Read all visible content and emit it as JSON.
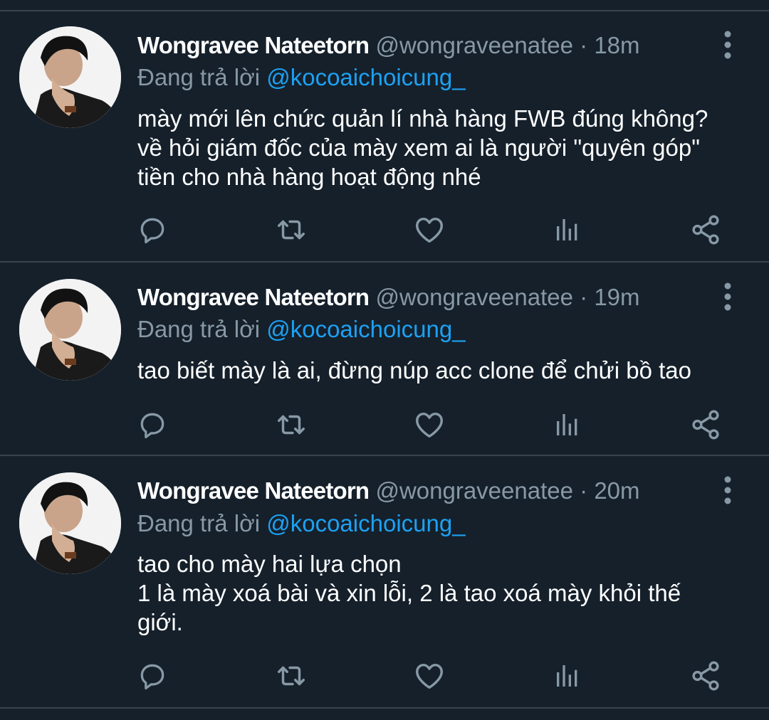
{
  "tweets": [
    {
      "author_name": "Wongravee Nateetorn",
      "handle": "@wongraveenatee",
      "separator": "·",
      "time": "18m",
      "reply_prefix": "Đang trả lời",
      "reply_to": "@kocoaichoicung_",
      "lines": [
        "mày mới lên chức quản lí nhà hàng FWB đúng không?",
        "về hỏi giám đốc của mày xem ai là người \"quyên góp\"",
        "tiền cho nhà hàng hoạt động nhé"
      ]
    },
    {
      "author_name": "Wongravee Nateetorn",
      "handle": "@wongraveenatee",
      "separator": "·",
      "time": "19m",
      "reply_prefix": "Đang trả lời",
      "reply_to": "@kocoaichoicung_",
      "lines": [
        "tao biết mày là ai, đừng núp acc clone để chửi bồ tao"
      ]
    },
    {
      "author_name": "Wongravee Nateetorn",
      "handle": "@wongraveenatee",
      "separator": "·",
      "time": "20m",
      "reply_prefix": "Đang trả lời",
      "reply_to": "@kocoaichoicung_",
      "lines": [
        "tao cho mày hai lựa chọn",
        "1 là mày xoá bài và xin lỗi, 2 là tao xoá mày khỏi thế",
        "giới."
      ]
    }
  ],
  "action_icons": [
    "reply-icon",
    "retweet-icon",
    "like-icon",
    "analytics-icon",
    "share-icon"
  ],
  "colors": {
    "background": "#15202b",
    "divider": "#38444d",
    "text_primary": "#ffffff",
    "text_secondary": "#8899a6",
    "mention": "#1da1f2"
  }
}
